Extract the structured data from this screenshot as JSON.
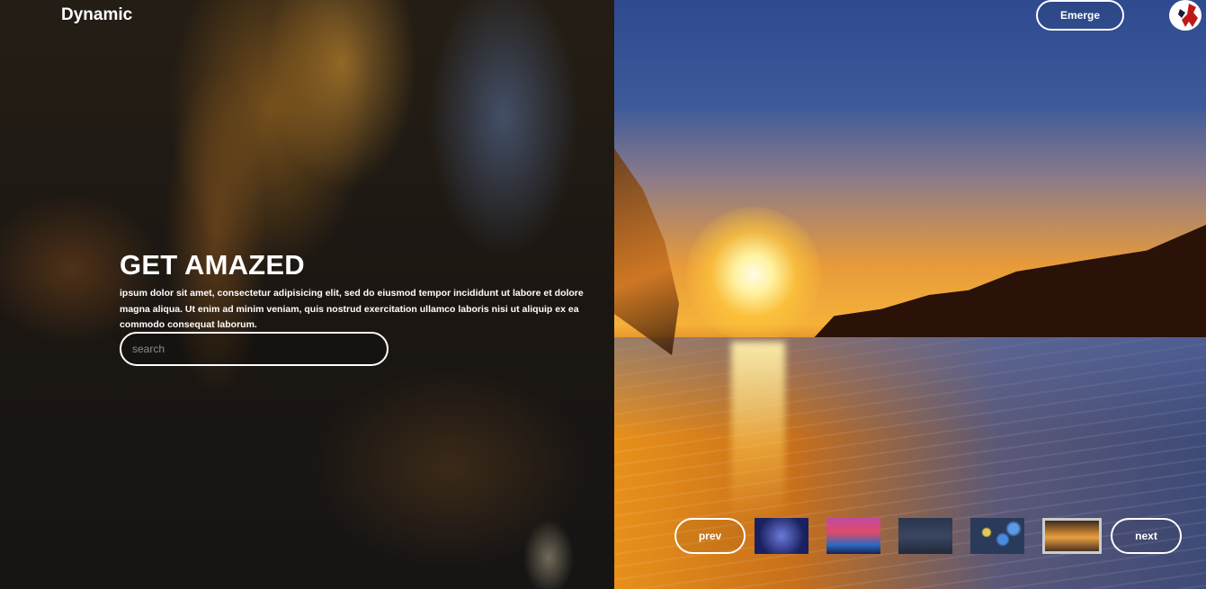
{
  "header": {
    "brand": "Dynamic",
    "emerge_label": "Emerge"
  },
  "hero": {
    "title": "GET AMAZED",
    "text": "ipsum dolor sit amet, consectetur adipisicing elit, sed do eiusmod tempor incididunt ut labore et dolore magna aliqua. Ut enim ad minim veniam, quis nostrud exercitation ullamco laboris nisi ut aliquip ex ea commodo consequat laborum.",
    "search": {
      "placeholder": "search",
      "value": ""
    }
  },
  "carousel": {
    "prev_label": "prev",
    "next_label": "next",
    "thumbnails": [
      {
        "selected": false
      },
      {
        "selected": false
      },
      {
        "selected": false
      },
      {
        "selected": false
      },
      {
        "selected": true
      }
    ]
  }
}
